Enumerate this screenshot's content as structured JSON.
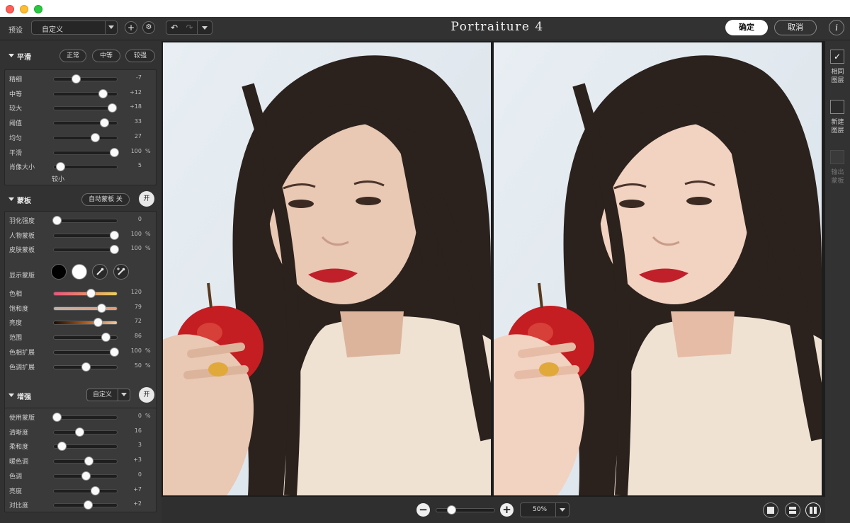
{
  "window": {
    "controls": [
      "close",
      "minimize",
      "zoom"
    ]
  },
  "toolbar": {
    "preset_label": "预设",
    "preset_value": "自定义",
    "add_icon": "+",
    "settings_icon": "⚙",
    "undo_icon": "↶",
    "redo_icon": "↷",
    "app_title": "Portraiture 4",
    "ok_label": "确定",
    "cancel_label": "取消",
    "info_icon": "i"
  },
  "smoothing": {
    "title": "平滑",
    "presets": [
      "正常",
      "中等",
      "较强"
    ],
    "sliders": [
      {
        "label": "精细",
        "value": "-7",
        "unit": "",
        "pos": 0.35
      },
      {
        "label": "中等",
        "value": "+12",
        "unit": "",
        "pos": 0.78
      },
      {
        "label": "较大",
        "value": "+18",
        "unit": "",
        "pos": 0.92
      },
      {
        "label": "阈值",
        "value": "33",
        "unit": "",
        "pos": 0.8
      },
      {
        "label": "均匀",
        "value": "27",
        "unit": "",
        "pos": 0.65
      },
      {
        "label": "平滑",
        "value": "100",
        "unit": "%",
        "pos": 0.95
      },
      {
        "label": "肖像大小",
        "value": "5",
        "unit": "",
        "pos": 0.1
      }
    ],
    "portrait_size_note": "较小"
  },
  "mask": {
    "title": "蒙板",
    "auto_mask_label": "自动蒙板 关",
    "on_label": "开",
    "sliders": [
      {
        "label": "羽化强度",
        "value": "0",
        "unit": "",
        "pos": 0.05
      },
      {
        "label": "人物蒙板",
        "value": "100",
        "unit": "%",
        "pos": 0.95
      },
      {
        "label": "皮肤蒙板",
        "value": "100",
        "unit": "%",
        "pos": 0.95
      }
    ],
    "show_mask_label": "显示蒙版",
    "color_sliders": [
      {
        "label": "色相",
        "value": "120",
        "unit": "",
        "pos": 0.58
      },
      {
        "label": "饱和度",
        "value": "79",
        "unit": "",
        "pos": 0.75
      },
      {
        "label": "亮度",
        "value": "72",
        "unit": "",
        "pos": 0.7
      },
      {
        "label": "范围",
        "value": "86",
        "unit": "",
        "pos": 0.82
      },
      {
        "label": "色相扩展",
        "value": "100",
        "unit": "%",
        "pos": 0.95
      },
      {
        "label": "色调扩展",
        "value": "50",
        "unit": "%",
        "pos": 0.5
      }
    ]
  },
  "enhance": {
    "title": "增强",
    "preset_value": "自定义",
    "on_label": "开",
    "sliders": [
      {
        "label": "使用蒙版",
        "value": "0",
        "unit": "%",
        "pos": 0.05
      },
      {
        "label": "清晰度",
        "value": "16",
        "unit": "",
        "pos": 0.4
      },
      {
        "label": "柔和度",
        "value": "3",
        "unit": "",
        "pos": 0.12
      },
      {
        "label": "暖色调",
        "value": "+3",
        "unit": "",
        "pos": 0.55
      },
      {
        "label": "色调",
        "value": "0",
        "unit": "",
        "pos": 0.5
      },
      {
        "label": "亮度",
        "value": "+7",
        "unit": "",
        "pos": 0.65
      },
      {
        "label": "对比度",
        "value": "+2",
        "unit": "",
        "pos": 0.54
      }
    ]
  },
  "zoom": {
    "value": "50%",
    "minus_icon": "−",
    "plus_icon": "+",
    "slider_pos": 0.25
  },
  "right_panel": {
    "same_layer": [
      "相同",
      "图层"
    ],
    "new_layer": [
      "新建",
      "图层"
    ],
    "output_mask": [
      "输出",
      "蒙板"
    ],
    "same_layer_checked": "✓"
  },
  "colors": {
    "panel_bg": "#323232",
    "box_bg": "#3a3a3a",
    "canvas_bg": "#1d1d1d",
    "accent_white": "#ffffff"
  }
}
